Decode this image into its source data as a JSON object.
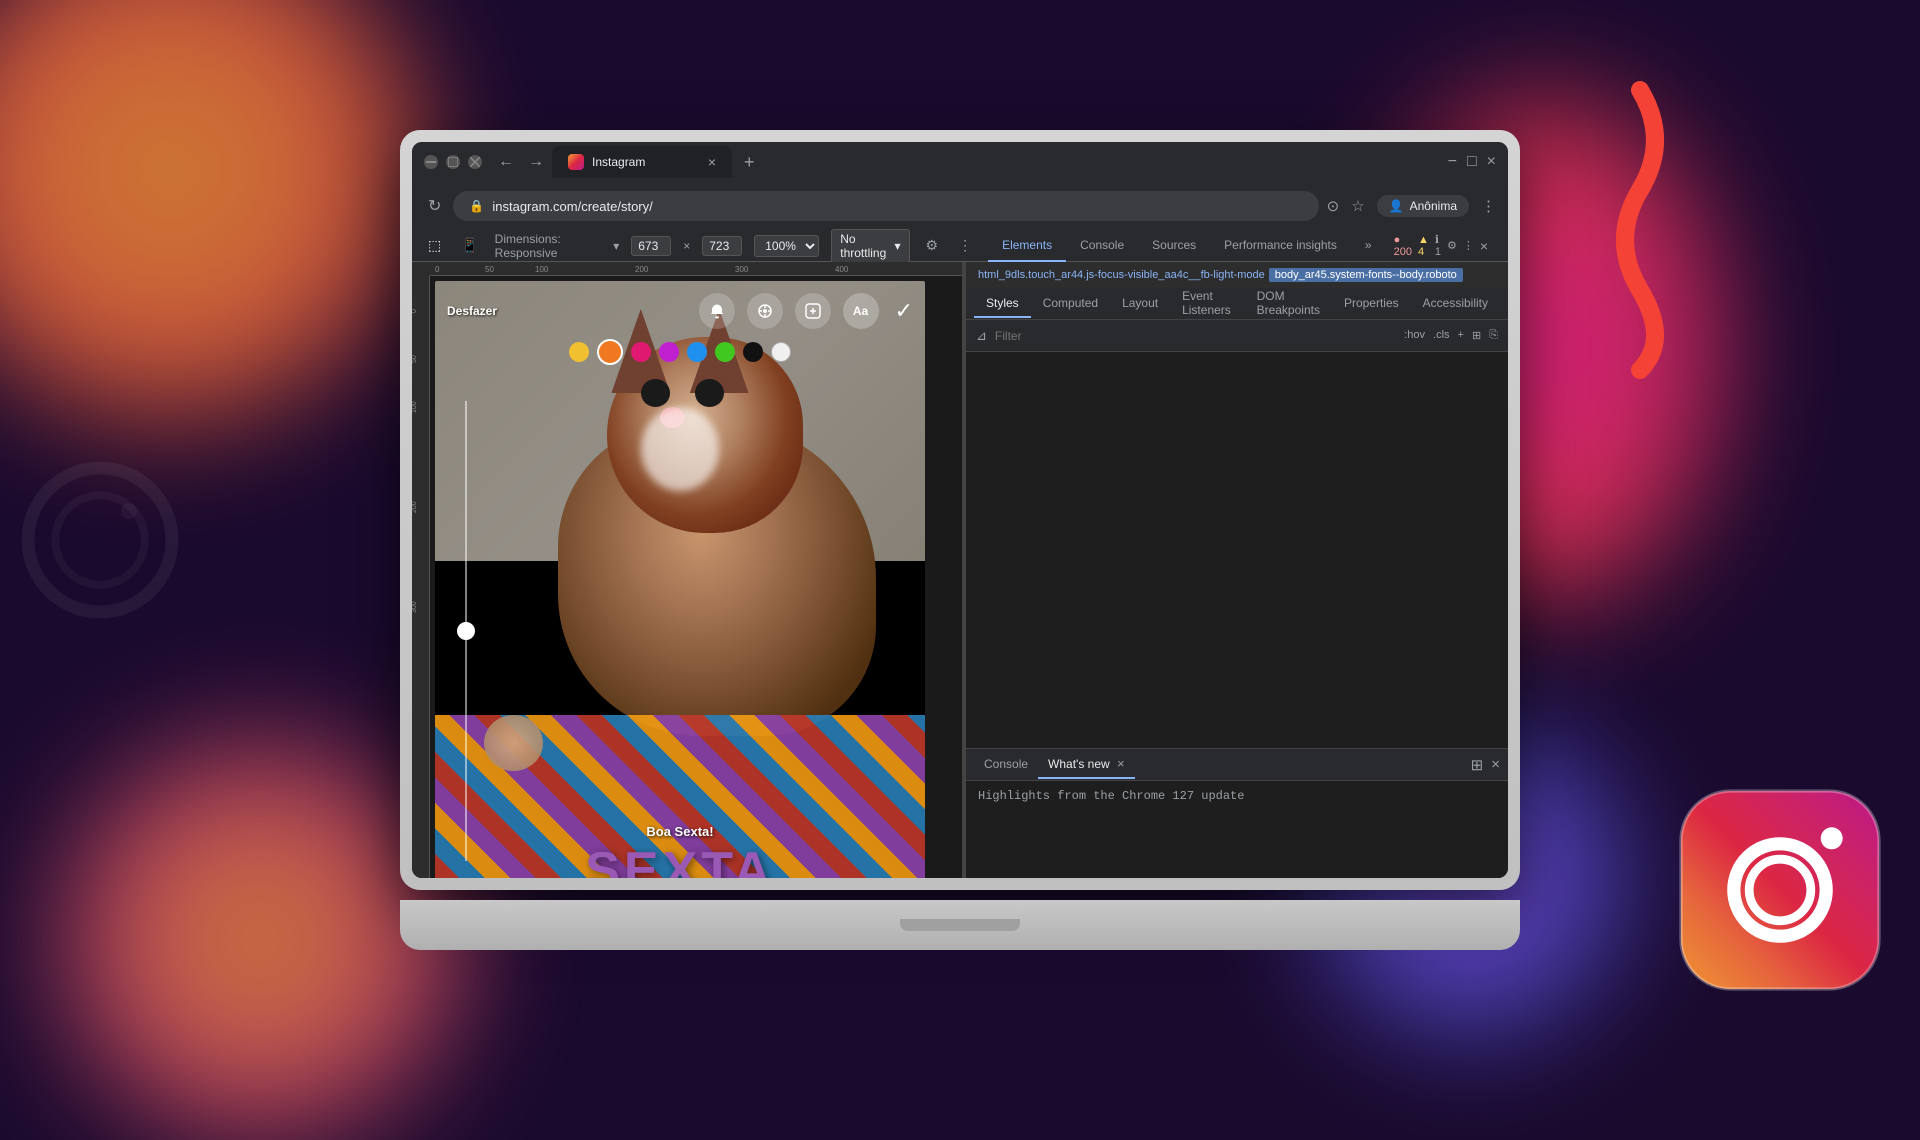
{
  "background": {
    "color": "#1a0a2e"
  },
  "browser": {
    "title_bar": {
      "tab_label": "Instagram",
      "tab_close": "×",
      "tab_new": "+",
      "minimize": "−",
      "maximize": "□",
      "close": "×"
    },
    "address_bar": {
      "back": "←",
      "forward": "→",
      "refresh": "↻",
      "url": "instagram.com/create/story/",
      "lock_icon": "🔒",
      "profile": "Anônima",
      "profile_icon": "👤",
      "more": "⋮"
    },
    "responsive_bar": {
      "dimensions_label": "Dimensions: Responsive",
      "width": "673",
      "x_label": "×",
      "height": "723",
      "zoom": "100%",
      "throttle": "No throttling",
      "throttle_icon": "▾"
    }
  },
  "devtools": {
    "tabs": [
      {
        "label": "Elements",
        "active": true
      },
      {
        "label": "Console",
        "active": false
      },
      {
        "label": "Sources",
        "active": false
      },
      {
        "label": "Performance insights",
        "active": false
      }
    ],
    "more_tabs": "»",
    "errors": "● 200",
    "warnings": "▲ 4",
    "info": "ℹ 1",
    "settings_icon": "⚙",
    "more_icon": "⋮",
    "close_icon": "×",
    "inspect_icon": "⬚",
    "device_icon": "📱",
    "element_breadcrumb": {
      "item1": "html_9dls.touch_ar44.js-focus-visible_aa4c__fb-light-mode",
      "item2": "body_ar45.system-fonts--body.roboto"
    },
    "styles_tabs": [
      {
        "label": "Styles",
        "active": true
      },
      {
        "label": "Computed",
        "active": false
      },
      {
        "label": "Layout",
        "active": false
      },
      {
        "label": "Event Listeners",
        "active": false
      },
      {
        "label": "DOM Breakpoints",
        "active": false
      },
      {
        "label": "Properties",
        "active": false
      },
      {
        "label": "Accessibility",
        "active": false
      }
    ],
    "filter": {
      "placeholder": "Filter",
      "filter_icon": "⊿",
      "hov_label": ":hov",
      "cls_label": ".cls",
      "plus_icon": "+",
      "layout_icon": "⊞",
      "copy_icon": "⎘"
    },
    "console_panel": {
      "tabs": [
        {
          "label": "Console",
          "active": false
        },
        {
          "label": "What's new",
          "active": true,
          "closeable": true
        }
      ],
      "message": "Highlights from the Chrome 127 update",
      "close_icon": "×"
    }
  },
  "instagram": {
    "undo_label": "Desfazer",
    "tools": [
      {
        "icon": "🔔",
        "label": "bell-icon"
      },
      {
        "icon": "⊕",
        "label": "ar-icon"
      },
      {
        "icon": "😊",
        "label": "sticker-icon"
      },
      {
        "icon": "Aa",
        "label": "text-icon"
      }
    ],
    "checkmark": "✓",
    "colors": [
      {
        "color": "#f0c030",
        "size": "22px"
      },
      {
        "color": "#f07820",
        "size": "28px"
      },
      {
        "color": "#e01870",
        "size": "22px"
      },
      {
        "color": "#c020d0",
        "size": "22px"
      },
      {
        "color": "#2090f0",
        "size": "22px"
      },
      {
        "color": "#40c820",
        "size": "22px"
      },
      {
        "color": "#111111",
        "size": "22px"
      },
      {
        "color": "#f0f0f0",
        "size": "22px"
      }
    ],
    "story_title": "Boa Sexta!",
    "story_main_text": "SEXTA",
    "story_text_color": "#7b5ea7",
    "bottom_indicator": "— —"
  }
}
